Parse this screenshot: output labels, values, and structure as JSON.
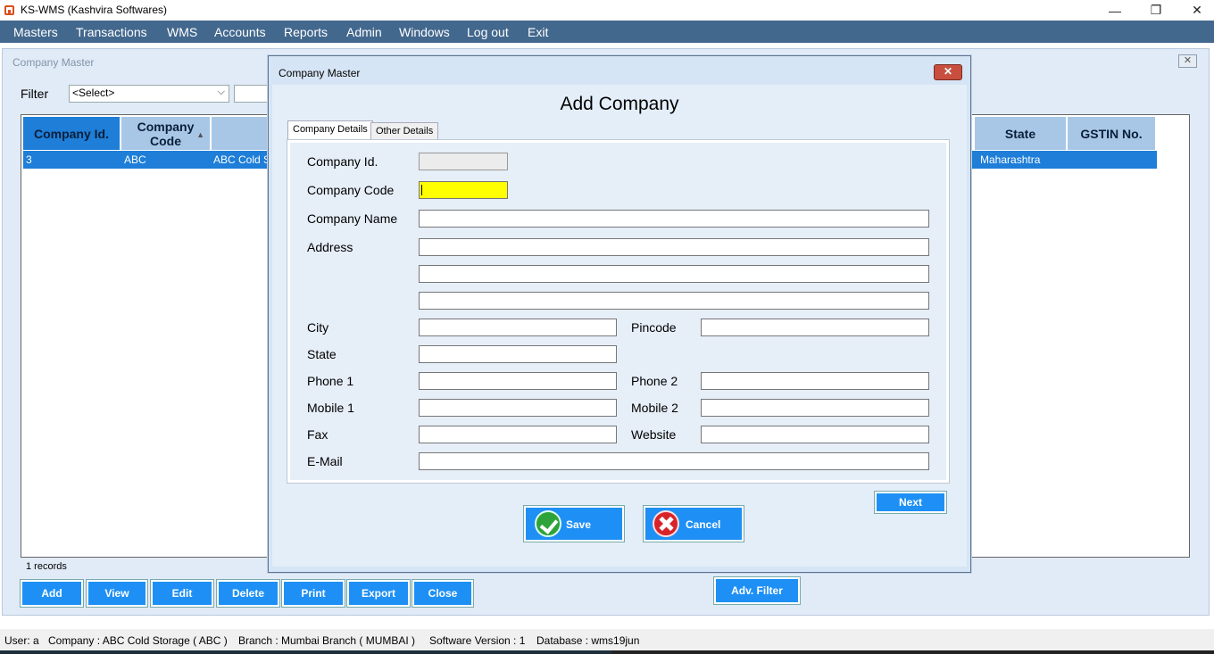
{
  "window": {
    "title": "KS-WMS (Kashvira Softwares)",
    "minimize": "—",
    "restore": "❐",
    "close": "✕"
  },
  "menu": [
    "Masters",
    "Transactions",
    "WMS",
    "Accounts",
    "Reports",
    "Admin",
    "Windows",
    "Log out",
    "Exit"
  ],
  "company_master": {
    "title": "Company Master",
    "close": "✕",
    "filter_label": "Filter",
    "filter_select": "<Select>",
    "chevron": "⌵",
    "sort_icon": "▲",
    "columns": {
      "company_id": "Company Id.",
      "company_code": "Company Code",
      "state": "State",
      "gstin": "GSTIN No."
    },
    "row": {
      "company_id": "3",
      "company_code": "ABC",
      "company_name": "ABC Cold S",
      "state": "Maharashtra"
    },
    "records": "1 records",
    "buttons": {
      "add": "Add",
      "view": "View",
      "edit": "Edit",
      "delete": "Delete",
      "print": "Print",
      "export": "Export",
      "close": "Close",
      "adv_filter": "Adv. Filter"
    }
  },
  "dialog": {
    "title": "Company Master",
    "close": "✕",
    "heading": "Add Company",
    "tabs": {
      "details": "Company Details",
      "other": "Other Details"
    },
    "labels": {
      "company_id": "Company Id.",
      "company_code": "Company Code",
      "company_name": "Company Name",
      "address": "Address",
      "city": "City",
      "pincode": "Pincode",
      "state": "State",
      "phone1": "Phone 1",
      "phone2": "Phone 2",
      "mobile1": "Mobile 1",
      "mobile2": "Mobile 2",
      "fax": "Fax",
      "website": "Website",
      "email": "E-Mail"
    },
    "values": {
      "company_id": "",
      "company_code": ""
    },
    "buttons": {
      "next": "Next",
      "save": "Save",
      "cancel": "Cancel"
    }
  },
  "status": {
    "user": "User: a",
    "company": "Company : ABC Cold Storage ( ABC )",
    "branch": "Branch : Mumbai Branch ( MUMBAI )",
    "version": "Software Version : 1",
    "database": "Database : wms19jun"
  },
  "colors": {
    "menu_bg": "#43688e",
    "selection": "#1e7ed8",
    "button": "#1e90f5",
    "focus_field": "#ffff00"
  }
}
